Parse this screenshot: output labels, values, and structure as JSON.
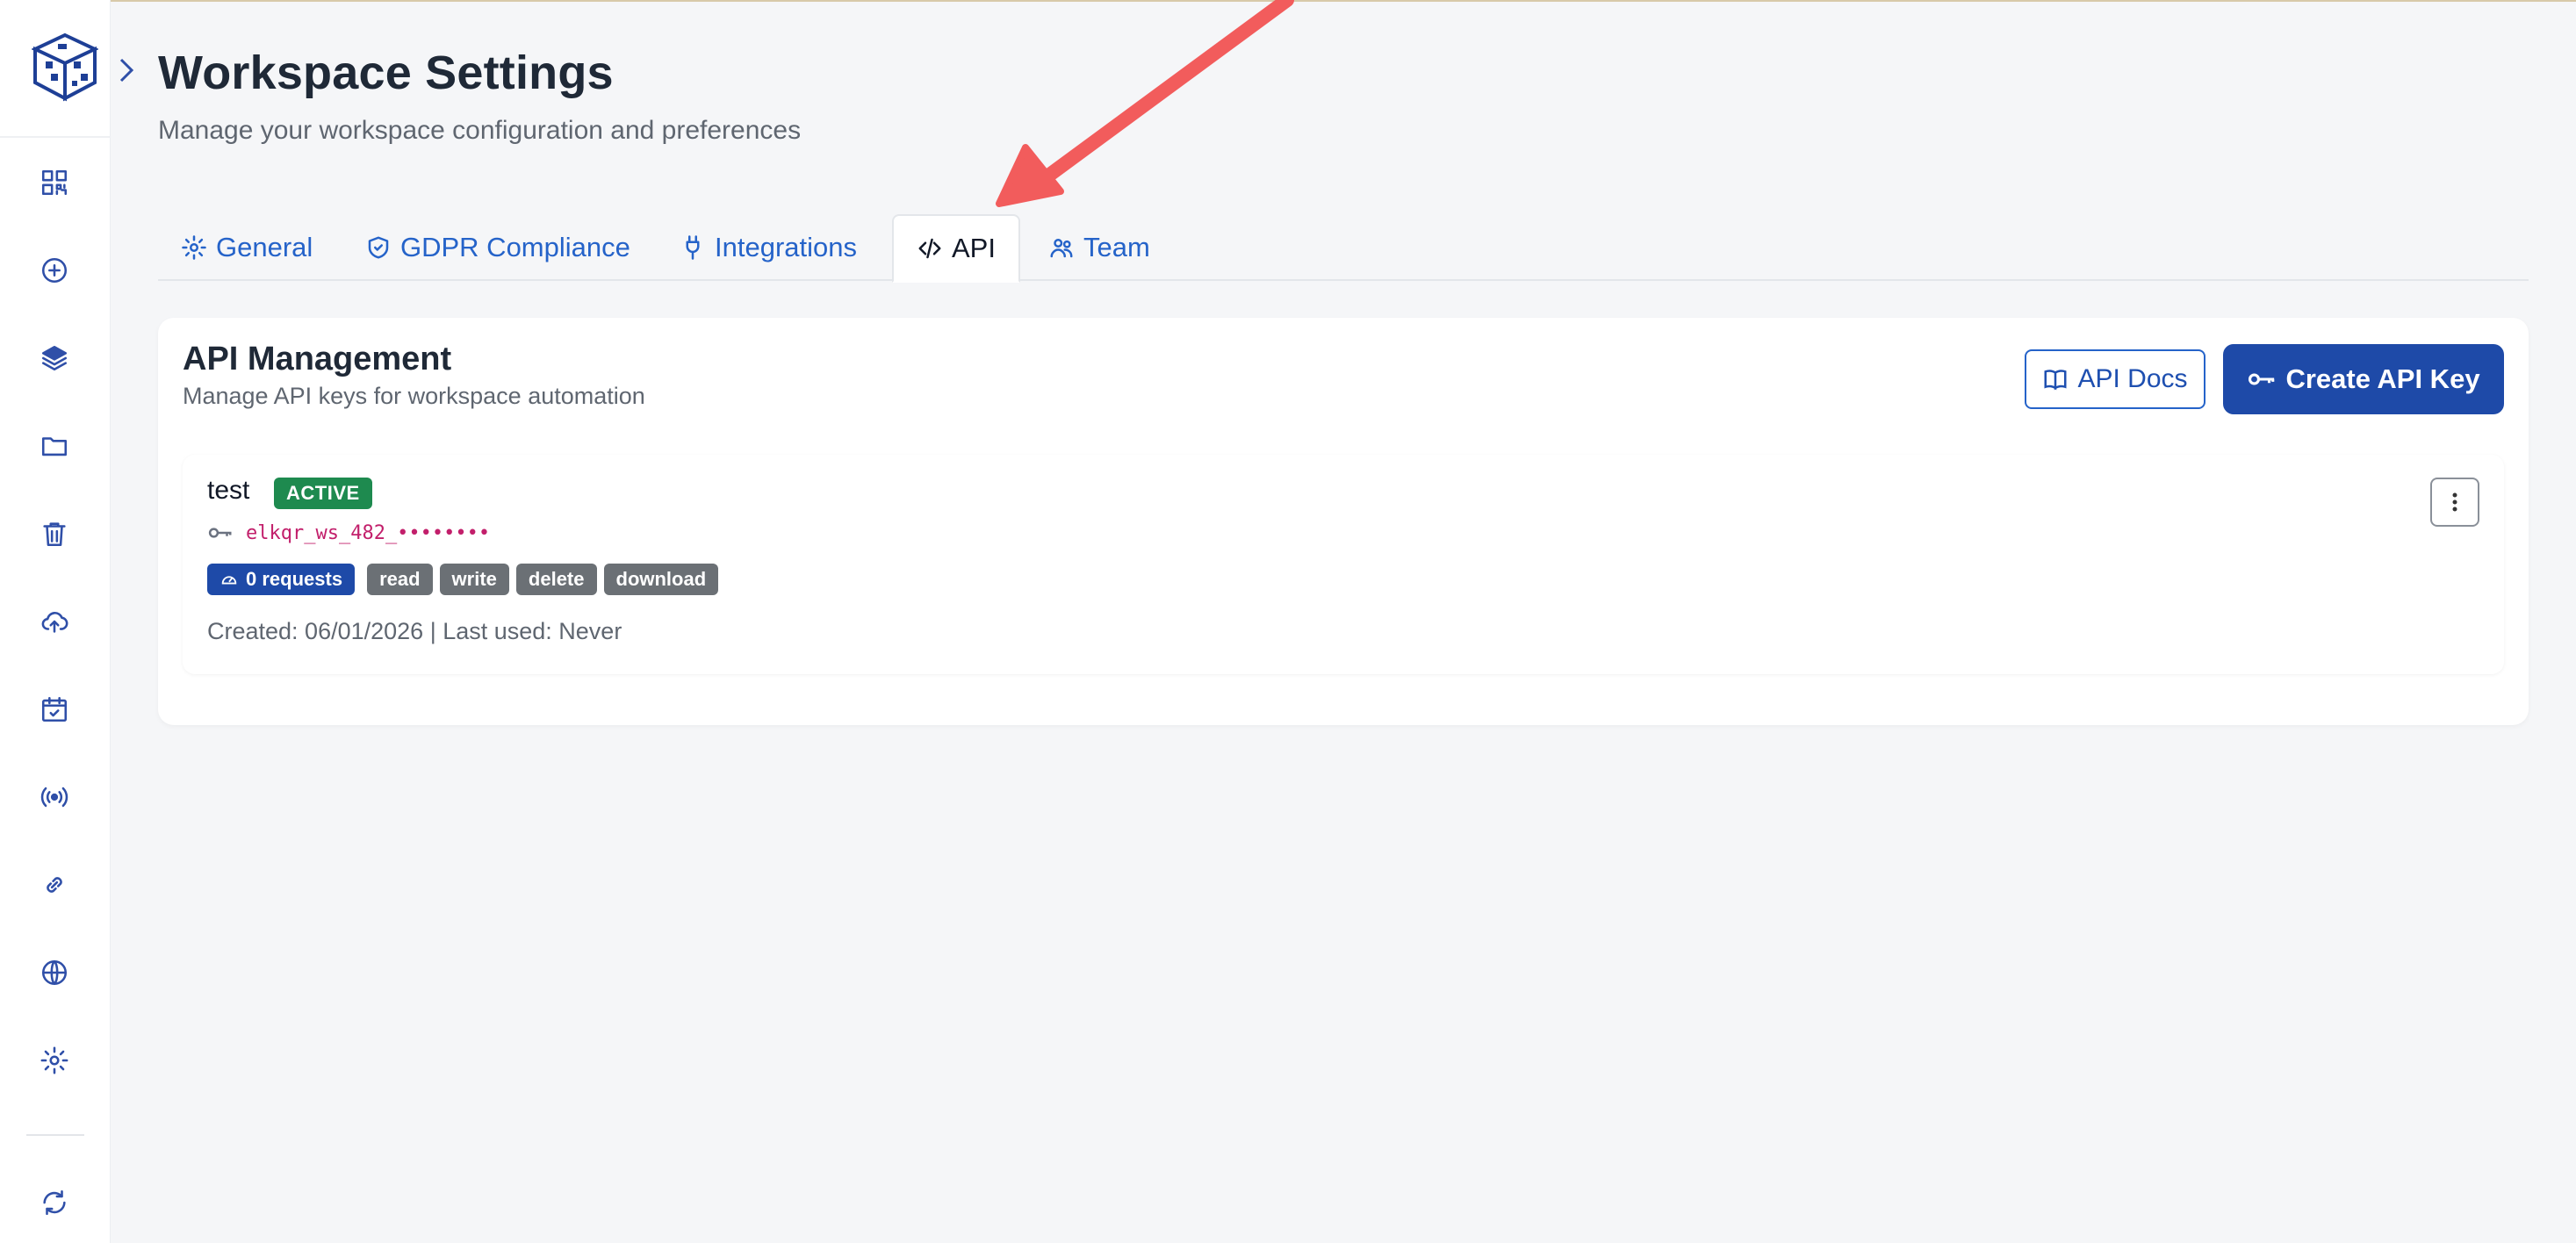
{
  "header": {
    "title": "Workspace Settings",
    "subtitle": "Manage your workspace configuration and preferences"
  },
  "sidebar": {
    "icons": [
      "qr-code-icon",
      "add-circle-icon",
      "layers-icon",
      "folder-icon",
      "trash-icon",
      "cloud-upload-icon",
      "calendar-check-icon",
      "broadcast-icon",
      "link-icon",
      "globe-icon",
      "gear-icon",
      "refresh-icon"
    ]
  },
  "tabs": [
    {
      "label": "General",
      "icon": "gear-icon"
    },
    {
      "label": "GDPR Compliance",
      "icon": "shield-icon"
    },
    {
      "label": "Integrations",
      "icon": "plug-icon"
    },
    {
      "label": "API",
      "icon": "code-icon",
      "active": true
    },
    {
      "label": "Team",
      "icon": "users-icon"
    }
  ],
  "api": {
    "title": "API Management",
    "subtitle": "Manage API keys for workspace automation",
    "docs_label": "API Docs",
    "create_label": "Create API Key",
    "keys": [
      {
        "name": "test",
        "status": "ACTIVE",
        "prefix": "elkqr_ws_482_••••••••",
        "requests": "0 requests",
        "scopes": [
          "read",
          "write",
          "delete",
          "download"
        ],
        "meta": "Created: 06/01/2026 | Last used: Never"
      }
    ]
  },
  "colors": {
    "primary": "#1e4aa8",
    "link": "#2563c9",
    "success": "#1e8a4f",
    "scope_chip": "#6b7075",
    "key_text": "#c21f6b",
    "annotation_arrow": "#f25c5c"
  }
}
